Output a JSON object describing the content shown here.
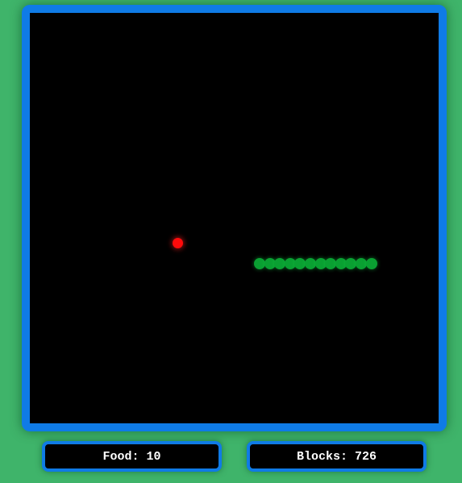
{
  "game": {
    "title": "",
    "snake_segment_count": 12,
    "colors": {
      "background": "#3fb46a",
      "board": "#000000",
      "border": "#0f7be6",
      "snake": "#0aa032",
      "food": "#ff0b0b",
      "text": "#ffffff"
    }
  },
  "stats": {
    "food_label": "Food:",
    "food_value": "10",
    "blocks_label": "Blocks:",
    "blocks_value": "726"
  }
}
